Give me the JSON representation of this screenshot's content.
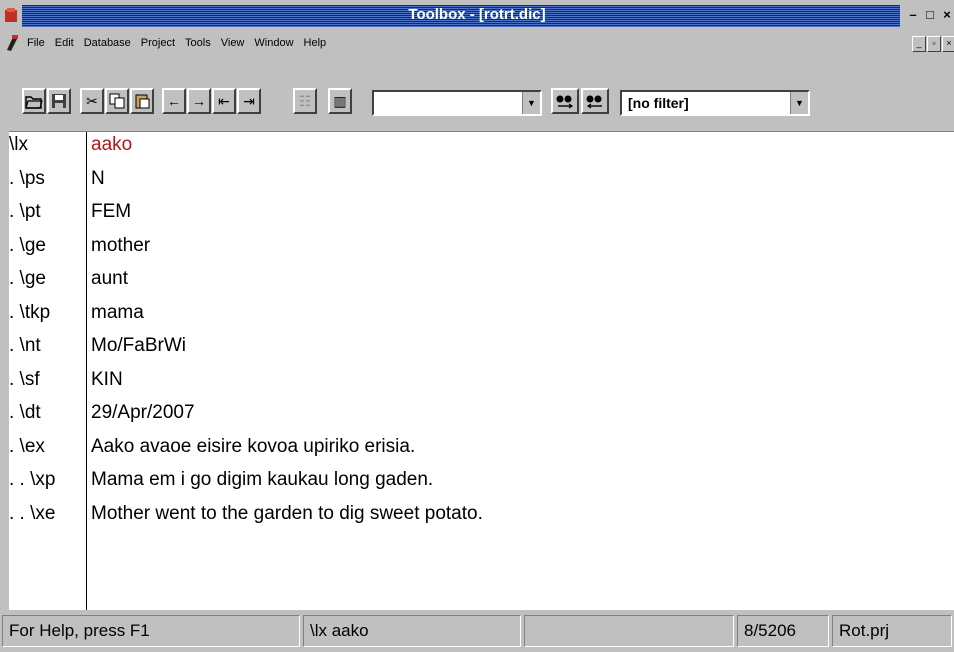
{
  "window": {
    "title": "Toolbox - [rotrt.dic]",
    "accent": "#0a2a8a"
  },
  "menu": {
    "items": [
      "File",
      "Edit",
      "Database",
      "Project",
      "Tools",
      "View",
      "Window",
      "Help"
    ]
  },
  "toolbar": {
    "buttons": [
      {
        "name": "open-icon",
        "glyph": "📂"
      },
      {
        "name": "save-icon",
        "glyph": "💾"
      },
      {
        "name": "cut-icon",
        "glyph": "✂"
      },
      {
        "name": "copy-icon",
        "glyph": "⧉"
      },
      {
        "name": "paste-icon",
        "glyph": "📋"
      },
      {
        "name": "prev-record-icon",
        "glyph": "←"
      },
      {
        "name": "next-record-icon",
        "glyph": "→"
      },
      {
        "name": "first-record-icon",
        "glyph": "⇤"
      },
      {
        "name": "last-record-icon",
        "glyph": "⇥"
      },
      {
        "name": "browse-view-icon",
        "glyph": "☷"
      },
      {
        "name": "columns-icon",
        "glyph": "▥"
      }
    ],
    "search_value": "",
    "find_icons": [
      "find-prev-icon",
      "find-next-icon"
    ],
    "filter_value": "[no filter]"
  },
  "record": {
    "fields": [
      {
        "marker": "\\lx",
        "value": "aako",
        "highlight": true
      },
      {
        "marker": ". \\ps",
        "value": "N"
      },
      {
        "marker": ". \\pt",
        "value": "FEM"
      },
      {
        "marker": ". \\ge",
        "value": "mother"
      },
      {
        "marker": ". \\ge",
        "value": "aunt"
      },
      {
        "marker": ". \\tkp",
        "value": "mama"
      },
      {
        "marker": ". \\nt",
        "value": "Mo/FaBrWi"
      },
      {
        "marker": ". \\sf",
        "value": "KIN"
      },
      {
        "marker": ". \\dt",
        "value": "29/Apr/2007"
      },
      {
        "marker": ". \\ex",
        "value": "Aako avaoe eisire kovoa upiriko erisia."
      },
      {
        "marker": ". . \\xp",
        "value": "Mama em i go digim kaukau long gaden."
      },
      {
        "marker": ". . \\xe",
        "value": "Mother went to the garden to dig sweet potato."
      }
    ],
    "lx_color": "#b01818"
  },
  "status": {
    "help": "For Help, press F1",
    "current": "\\lx aako",
    "blank": "",
    "position": "8/5206",
    "project": "Rot.prj"
  }
}
